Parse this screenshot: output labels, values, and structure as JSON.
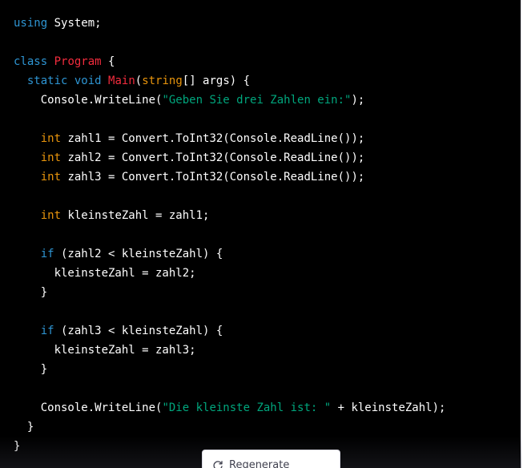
{
  "code": {
    "lines": [
      [
        [
          "kw",
          "using"
        ],
        [
          "pl",
          " System;"
        ]
      ],
      [],
      [
        [
          "kw",
          "class"
        ],
        [
          "pl",
          " "
        ],
        [
          "fn",
          "Program"
        ],
        [
          "pl",
          " {"
        ]
      ],
      [
        [
          "pl",
          "  "
        ],
        [
          "kw",
          "static"
        ],
        [
          "pl",
          " "
        ],
        [
          "kw",
          "void"
        ],
        [
          "pl",
          " "
        ],
        [
          "fn",
          "Main"
        ],
        [
          "pl",
          "("
        ],
        [
          "tp",
          "string"
        ],
        [
          "pl",
          "[] args) {"
        ]
      ],
      [
        [
          "pl",
          "    Console.WriteLine("
        ],
        [
          "str",
          "\"Geben Sie drei Zahlen ein:\""
        ],
        [
          "pl",
          ");"
        ]
      ],
      [],
      [
        [
          "pl",
          "    "
        ],
        [
          "tp",
          "int"
        ],
        [
          "pl",
          " zahl1 = Convert.ToInt32(Console.ReadLine());"
        ]
      ],
      [
        [
          "pl",
          "    "
        ],
        [
          "tp",
          "int"
        ],
        [
          "pl",
          " zahl2 = Convert.ToInt32(Console.ReadLine());"
        ]
      ],
      [
        [
          "pl",
          "    "
        ],
        [
          "tp",
          "int"
        ],
        [
          "pl",
          " zahl3 = Convert.ToInt32(Console.ReadLine());"
        ]
      ],
      [],
      [
        [
          "pl",
          "    "
        ],
        [
          "tp",
          "int"
        ],
        [
          "pl",
          " kleinsteZahl = zahl1;"
        ]
      ],
      [],
      [
        [
          "pl",
          "    "
        ],
        [
          "kw",
          "if"
        ],
        [
          "pl",
          " (zahl2 < kleinsteZahl) {"
        ]
      ],
      [
        [
          "pl",
          "      kleinsteZahl = zahl2;"
        ]
      ],
      [
        [
          "pl",
          "    }"
        ]
      ],
      [],
      [
        [
          "pl",
          "    "
        ],
        [
          "kw",
          "if"
        ],
        [
          "pl",
          " (zahl3 < kleinsteZahl) {"
        ]
      ],
      [
        [
          "pl",
          "      kleinsteZahl = zahl3;"
        ]
      ],
      [
        [
          "pl",
          "    }"
        ]
      ],
      [],
      [
        [
          "pl",
          "    Console.WriteLine("
        ],
        [
          "str",
          "\"Die kleinste Zahl ist: \""
        ],
        [
          "pl",
          " + kleinsteZahl);"
        ]
      ],
      [
        [
          "pl",
          "  }"
        ]
      ],
      [
        [
          "pl",
          "}"
        ]
      ]
    ]
  },
  "regenerate": {
    "label": "Regenerate response",
    "icon": "refresh-icon"
  },
  "colors": {
    "background": "#000000",
    "plain": "#ffffff",
    "keyword": "#2e95d3",
    "function_name": "#f22c3d",
    "type": "#e9950c",
    "string": "#00a67d"
  }
}
